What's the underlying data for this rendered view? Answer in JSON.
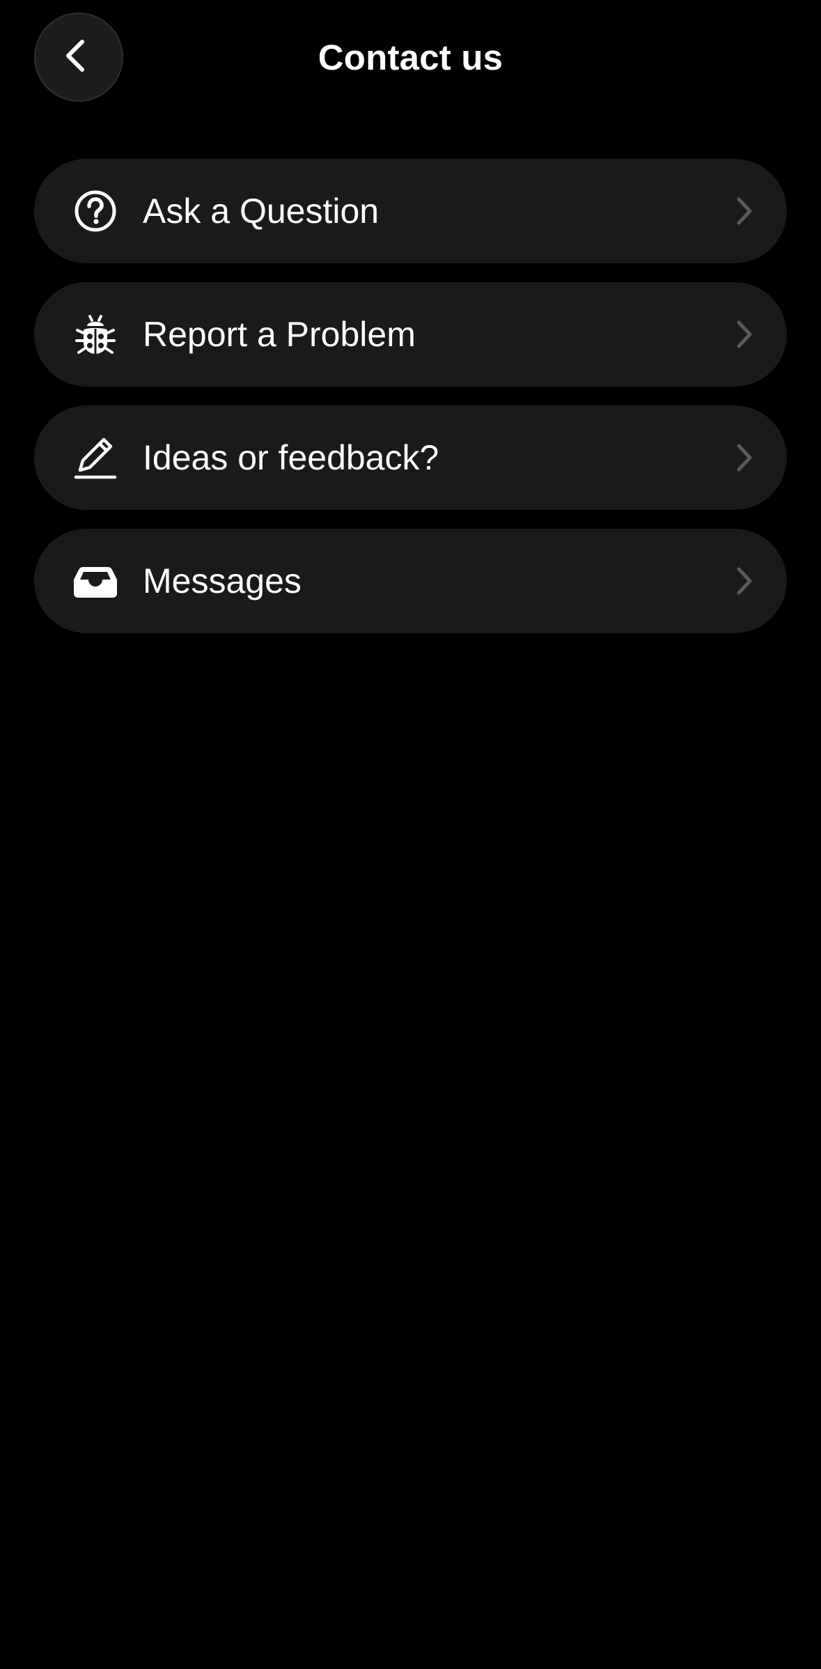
{
  "header": {
    "title": "Contact us",
    "back_icon": "chevron-left-icon"
  },
  "menu": {
    "items": [
      {
        "label": "Ask a Question",
        "icon": "question-circle-icon"
      },
      {
        "label": "Report a Problem",
        "icon": "bug-icon"
      },
      {
        "label": "Ideas or feedback?",
        "icon": "pencil-icon"
      },
      {
        "label": "Messages",
        "icon": "inbox-tray-icon"
      }
    ],
    "chevron_icon": "chevron-right-icon"
  },
  "colors": {
    "background": "#000000",
    "card": "#1a1a1a",
    "back_button": "#1c1c1e",
    "text": "#ffffff",
    "chevron": "#5a5a5e"
  }
}
